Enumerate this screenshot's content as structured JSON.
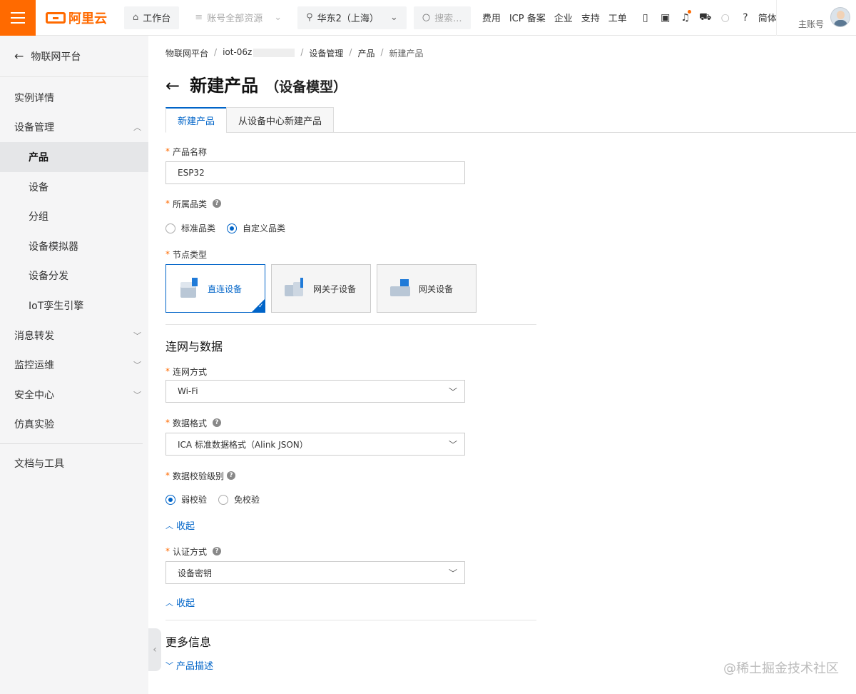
{
  "topbar": {
    "logo_text": "阿里云",
    "workbench": "工作台",
    "resources": "账号全部资源",
    "region": "华东2（上海）",
    "search_placeholder": "搜索...",
    "links": [
      "费用",
      "ICP 备案",
      "企业",
      "支持",
      "工单"
    ],
    "lang": "简体",
    "account": "主账号"
  },
  "sidebar": {
    "back_label": "物联网平台",
    "items": [
      {
        "label": "实例详情"
      },
      {
        "label": "设备管理"
      },
      {
        "label": "产品"
      },
      {
        "label": "设备"
      },
      {
        "label": "分组"
      },
      {
        "label": "设备模拟器"
      },
      {
        "label": "设备分发"
      },
      {
        "label": "IoT孪生引擎"
      },
      {
        "label": "消息转发"
      },
      {
        "label": "监控运维"
      },
      {
        "label": "安全中心"
      },
      {
        "label": "仿真实验"
      },
      {
        "label": "文档与工具"
      }
    ]
  },
  "breadcrumb": [
    "物联网平台",
    "iot-06z",
    "设备管理",
    "产品",
    "新建产品"
  ],
  "page": {
    "title": "新建产品",
    "subtitle": "（设备模型）",
    "tabs": [
      "新建产品",
      "从设备中心新建产品"
    ]
  },
  "form": {
    "product_name_label": "产品名称",
    "product_name_value": "ESP32",
    "category_label": "所属品类",
    "category_options": [
      "标准品类",
      "自定义品类"
    ],
    "node_type_label": "节点类型",
    "node_types": [
      "直连设备",
      "网关子设备",
      "网关设备"
    ],
    "network_section": "连网与数据",
    "network_method_label": "连网方式",
    "network_method_value": "Wi-Fi",
    "data_format_label": "数据格式",
    "data_format_value": "ICA 标准数据格式（Alink JSON）",
    "validation_label": "数据校验级别",
    "validation_options": [
      "弱校验",
      "免校验"
    ],
    "collapse_1": "收起",
    "auth_label": "认证方式",
    "auth_value": "设备密钥",
    "collapse_2": "收起",
    "more_section": "更多信息",
    "product_desc_link": "产品描述"
  },
  "watermark": "@稀土掘金技术社区",
  "colors": {
    "brand": "#ff6a00",
    "accent": "#0064c8"
  }
}
